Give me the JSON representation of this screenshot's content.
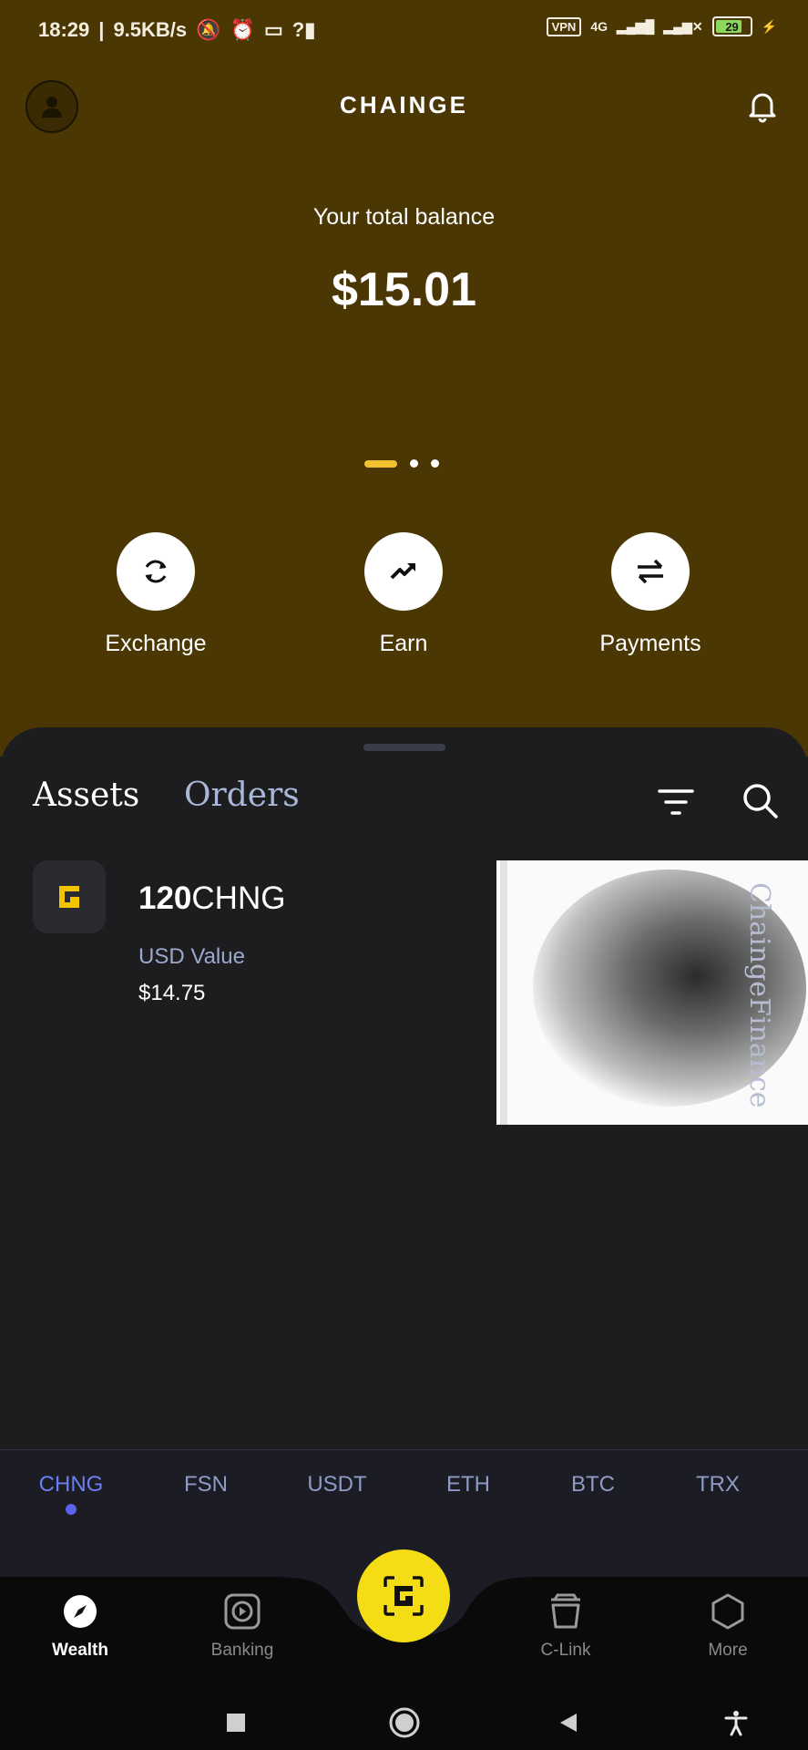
{
  "status_bar": {
    "time": "18:29",
    "speed": "9.5KB/s",
    "vpn": "VPN",
    "network": "4G",
    "battery": "29"
  },
  "header": {
    "title": "CHAINGE"
  },
  "balance": {
    "label": "Your total balance",
    "value": "$15.01"
  },
  "carousel": {
    "pages": 3,
    "active_index": 0
  },
  "actions": [
    {
      "label": "Exchange",
      "icon": "exchange-icon"
    },
    {
      "label": "Earn",
      "icon": "trending-up-icon"
    },
    {
      "label": "Payments",
      "icon": "transfer-arrows-icon"
    }
  ],
  "tabs": {
    "assets": "Assets",
    "orders": "Orders"
  },
  "asset": {
    "amount": "120",
    "symbol": "CHNG",
    "usd_label": "USD Value",
    "usd_value": "$14.75",
    "nft_watermark": "ChaingeFinance"
  },
  "coins": [
    "CHNG",
    "FSN",
    "USDT",
    "ETH",
    "BTC",
    "TRX"
  ],
  "active_coin": "CHNG",
  "bottom_nav": [
    {
      "label": "Wealth",
      "icon": "compass-icon",
      "active": true
    },
    {
      "label": "Banking",
      "icon": "banking-icon",
      "active": false
    },
    {
      "label": "C-Link",
      "icon": "bucket-icon",
      "active": false
    },
    {
      "label": "More",
      "icon": "hexagon-icon",
      "active": false
    }
  ],
  "colors": {
    "header_bg": "#4b3704",
    "sheet_bg": "#1d1d1f",
    "accent_yellow": "#f5dd16",
    "tab_inactive": "#a9b8d8",
    "coin_active": "#6d7ef0"
  }
}
